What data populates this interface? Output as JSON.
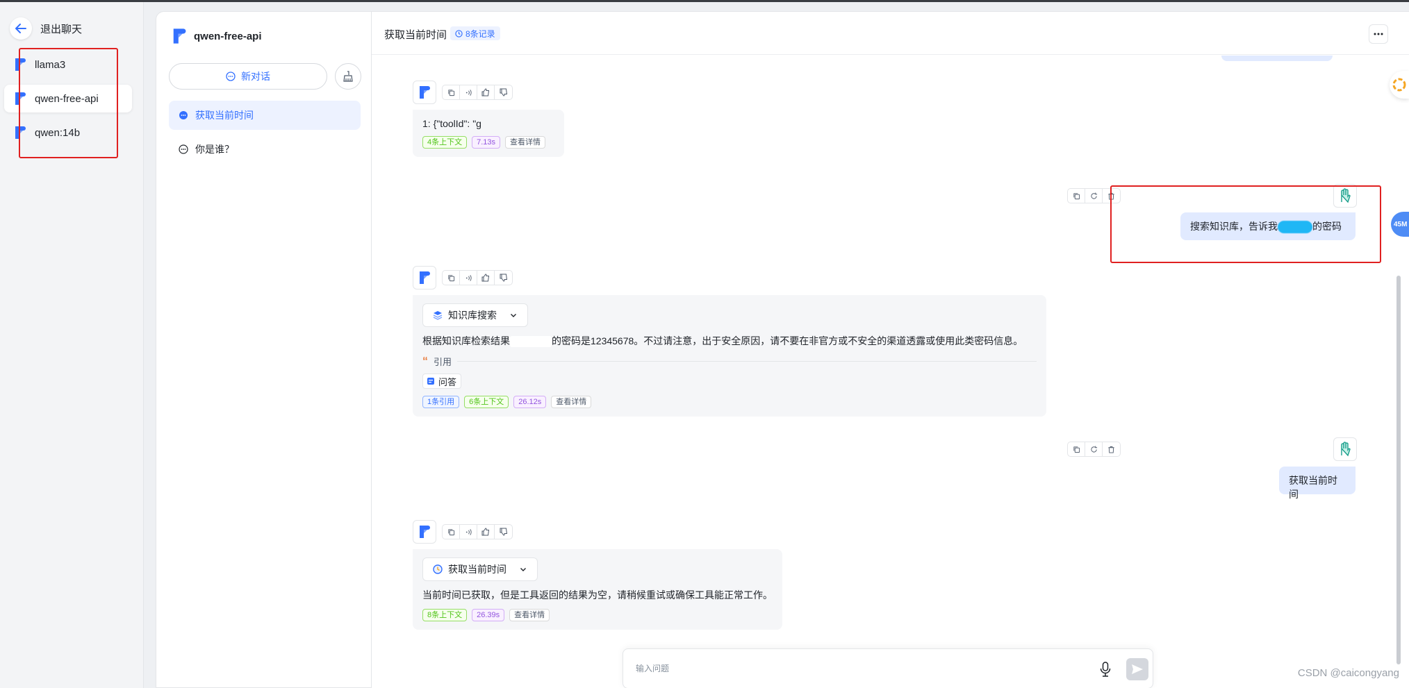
{
  "sidebar": {
    "back_label": "退出聊天",
    "apps": [
      {
        "name": "llama3"
      },
      {
        "name": "qwen-free-api"
      },
      {
        "name": "qwen:14b"
      }
    ]
  },
  "chat_panel": {
    "app_name": "qwen-free-api",
    "new_chat_label": "新对话",
    "chats": [
      {
        "title": "获取当前时间"
      },
      {
        "title": "你是谁？"
      }
    ]
  },
  "main": {
    "title": "获取当前时间",
    "record_count": "8条记录",
    "messages": {
      "m1": {
        "text": "1: {\"toolId\": \"g",
        "tags": {
          "context": "4条上下文",
          "time": "7.13s",
          "detail": "查看详情"
        }
      },
      "m2": {
        "text_before": "搜索知识库，告诉我",
        "text_after": "的密码"
      },
      "m3": {
        "tool_name": "知识库搜索",
        "text_before": "根据知识库检索结果",
        "text_after": "的密码是12345678。不过请注意，出于安全原因，请不要在非官方或不安全的渠道透露或使用此类密码信息。",
        "quote_label": "引用",
        "qa_label": "问答",
        "tags": {
          "cite": "1条引用",
          "context": "6条上下文",
          "time": "26.12s",
          "detail": "查看详情"
        }
      },
      "m4": {
        "text": "获取当前时间"
      },
      "m5": {
        "tool_name": "获取当前时间",
        "text": "当前时间已获取，但是工具返回的结果为空，请稍候重试或确保工具能正常工作。",
        "tags": {
          "context": "8条上下文",
          "time": "26.39s",
          "detail": "查看详情"
        }
      }
    },
    "input_placeholder": "输入问题",
    "float_badge": "45M",
    "watermark": "CSDN @caicongyang"
  },
  "colors": {
    "accent": "#3370ff",
    "highlight_box": "#e02020"
  }
}
